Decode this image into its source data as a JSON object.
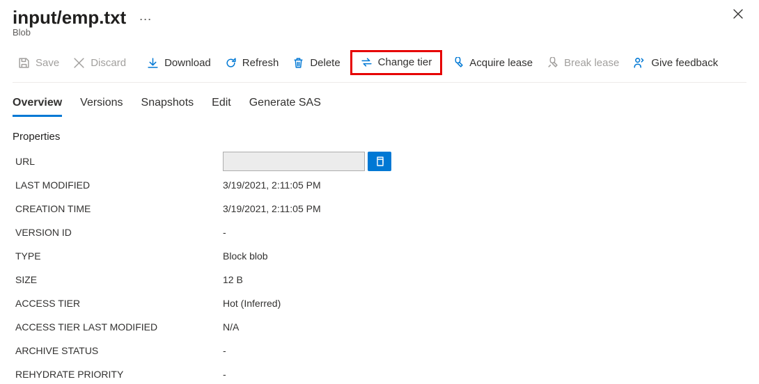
{
  "header": {
    "title": "input/emp.txt",
    "subtitle": "Blob"
  },
  "toolbar": {
    "save": "Save",
    "discard": "Discard",
    "download": "Download",
    "refresh": "Refresh",
    "delete": "Delete",
    "change_tier": "Change tier",
    "acquire_lease": "Acquire lease",
    "break_lease": "Break lease",
    "give_feedback": "Give feedback"
  },
  "tabs": {
    "overview": "Overview",
    "versions": "Versions",
    "snapshots": "Snapshots",
    "edit": "Edit",
    "generate_sas": "Generate SAS"
  },
  "section": {
    "properties": "Properties"
  },
  "props": {
    "url": {
      "label": "URL",
      "value": ""
    },
    "last_modified": {
      "label": "LAST MODIFIED",
      "value": "3/19/2021, 2:11:05 PM"
    },
    "creation_time": {
      "label": "CREATION TIME",
      "value": "3/19/2021, 2:11:05 PM"
    },
    "version_id": {
      "label": "VERSION ID",
      "value": "-"
    },
    "type": {
      "label": "TYPE",
      "value": "Block blob"
    },
    "size": {
      "label": "SIZE",
      "value": "12 B"
    },
    "access_tier": {
      "label": "ACCESS TIER",
      "value": "Hot (Inferred)"
    },
    "access_tier_last_modified": {
      "label": "ACCESS TIER LAST MODIFIED",
      "value": "N/A"
    },
    "archive_status": {
      "label": "ARCHIVE STATUS",
      "value": "-"
    },
    "rehydrate_priority": {
      "label": "REHYDRATE PRIORITY",
      "value": "-"
    }
  }
}
